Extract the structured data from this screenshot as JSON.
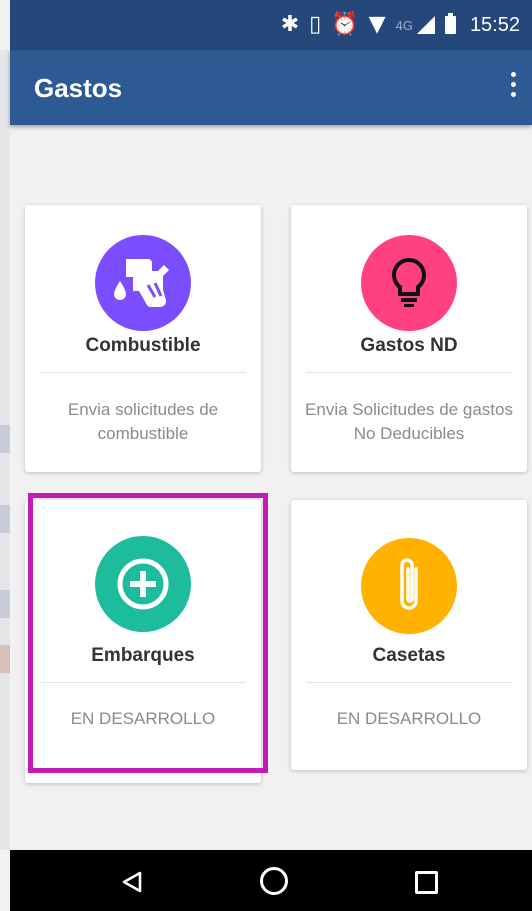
{
  "status_bar": {
    "network": "4G",
    "time": "15:52",
    "icons": [
      "bluetooth-icon",
      "vibrate-icon",
      "alarm-icon",
      "wifi-icon",
      "signal-icon",
      "battery-icon"
    ]
  },
  "app_bar": {
    "title": "Gastos",
    "menu_icon": "overflow-menu-icon"
  },
  "cards": [
    {
      "title": "Combustible",
      "description": "Envia solicitudes de combustible",
      "icon": "fuel-pump-icon",
      "color": "#7c4dff"
    },
    {
      "title": "Gastos ND",
      "description": "Envia Solicitudes de gastos No Deducibles",
      "icon": "lightbulb-icon",
      "color": "#ff4081"
    },
    {
      "title": "Embarques",
      "description": "EN DESARROLLO",
      "icon": "add-circle-icon",
      "color": "#1dbc9c"
    },
    {
      "title": "Casetas",
      "description": "EN DESARROLLO",
      "icon": "paperclip-icon",
      "color": "#ffb300"
    }
  ],
  "highlight_color": "#c41bb7",
  "nav_bar": {
    "buttons": [
      "back-icon",
      "home-icon",
      "recents-icon"
    ]
  }
}
